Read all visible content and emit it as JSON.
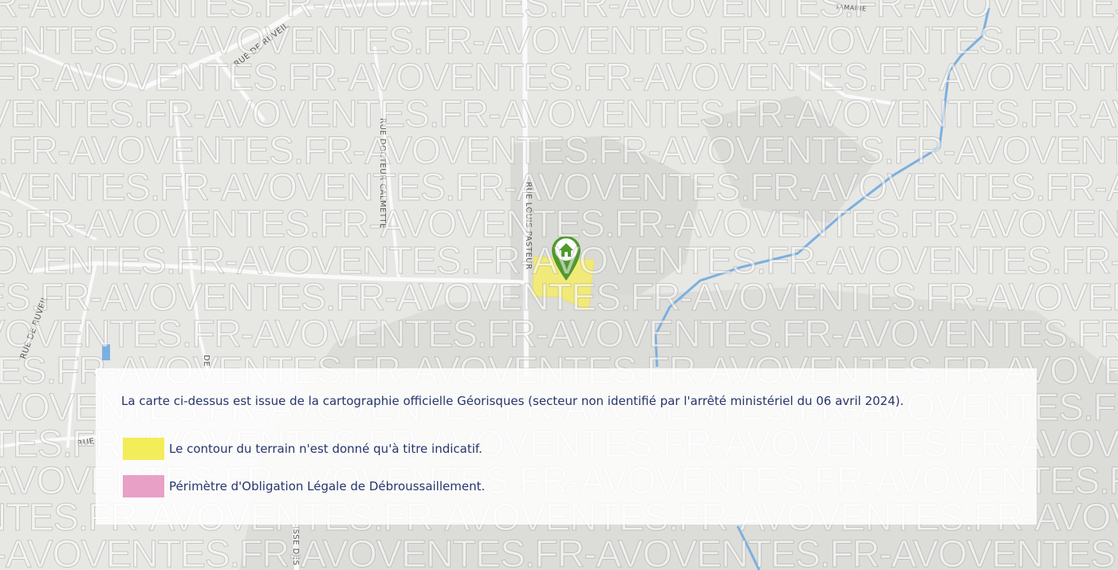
{
  "map": {
    "street_labels": [
      "RUE DE RUVEIL",
      "RUE DOCTEUR CALMETTE",
      "RUE LOUIS PASTEUR",
      "RUE DE RUVEIL",
      "DE",
      "RUE",
      "ISSE DES",
      "TAMAINE"
    ],
    "watermark_text": "FR-AVOVENTES.",
    "colors": {
      "background": "#e7e7e4",
      "road": "#fafafa",
      "river": "#7ab0e0",
      "parcel": "#f2ea78",
      "pin": "#4f9a2b",
      "legend_text": "#27356b"
    },
    "marker_icon": "house-pin-icon"
  },
  "legend": {
    "note": "La carte ci-dessus est issue de la cartographie officielle Géorisques (secteur non identifié par l'arrêté ministériel du 06 avril 2024).",
    "items": [
      {
        "label": "Le contour du terrain n'est donné qu'à titre indicatif.",
        "color": "#f3ed5a"
      },
      {
        "label": "Périmètre d'Obligation Légale de Débroussaillement.",
        "color": "#e9a0c6"
      }
    ]
  }
}
